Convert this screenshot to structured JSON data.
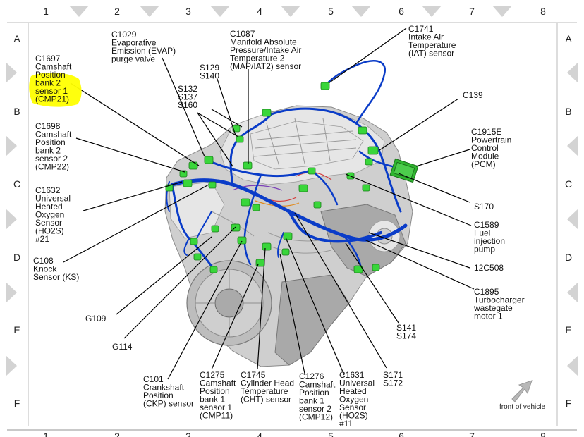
{
  "grid": {
    "columns": [
      "1",
      "2",
      "3",
      "4",
      "5",
      "6",
      "7",
      "8"
    ],
    "rows": [
      "A",
      "B",
      "C",
      "D",
      "E",
      "F"
    ]
  },
  "labels": {
    "c1697": [
      "C1697",
      "Camshaft",
      "Position",
      "bank 2",
      "sensor 1",
      "(CMP21)"
    ],
    "c1698": [
      "C1698",
      "Camshaft",
      "Position",
      "bank 2",
      "sensor 2",
      "(CMP22)"
    ],
    "c1632": [
      "C1632",
      "Universal",
      "Heated",
      "Oxygen",
      "Sensor",
      "(HO2S)",
      "#21"
    ],
    "c108": [
      "C108",
      "Knock",
      "Sensor (KS)"
    ],
    "g109": [
      "G109"
    ],
    "g114": [
      "G114"
    ],
    "c101": [
      "C101",
      "Crankshaft",
      "Position",
      "(CKP) sensor"
    ],
    "c1275": [
      "C1275",
      "Camshaft",
      "Position",
      "bank 1",
      "sensor 1",
      "(CMP11)"
    ],
    "c1745": [
      "C1745",
      "Cylinder Head",
      "Temperature",
      "(CHT) sensor"
    ],
    "c1276": [
      "C1276",
      "Camshaft",
      "Position",
      "bank 1",
      "sensor 2",
      "(CMP12)"
    ],
    "c1631": [
      "C1631",
      "Universal",
      "Heated",
      "Oxygen",
      "Sensor",
      "(HO2S)",
      "#11"
    ],
    "s171": [
      "S171",
      "S172"
    ],
    "s141": [
      "S141",
      "S174"
    ],
    "c1895": [
      "C1895",
      "Turbocharger",
      "wastegate",
      "motor 1"
    ],
    "c12c508": [
      "12C508"
    ],
    "c1589": [
      "C1589",
      "Fuel",
      "injection",
      "pump"
    ],
    "s170": [
      "S170"
    ],
    "c1915e": [
      "C1915E",
      "Powertrain",
      "Control",
      "Module",
      "(PCM)"
    ],
    "c139": [
      "C139"
    ],
    "c1741": [
      "C1741",
      "Intake Air",
      "Temperature",
      "(IAT) sensor"
    ],
    "c1087": [
      "C1087",
      "Manifold Absolute",
      "Pressure/Intake Air",
      "Temperature 2",
      "(MAP/IAT2) sensor"
    ],
    "c1029": [
      "C1029",
      "Evaporative",
      "Emission (EVAP)",
      "purge valve"
    ],
    "s129": [
      "S129",
      "S140"
    ],
    "s132": [
      "S132",
      "S137",
      "S160"
    ]
  },
  "front_of_vehicle": "front of vehicle",
  "highlight_color": "#ffff00",
  "harness_color": "#0a3cc8",
  "connector_color": "#39d63a"
}
